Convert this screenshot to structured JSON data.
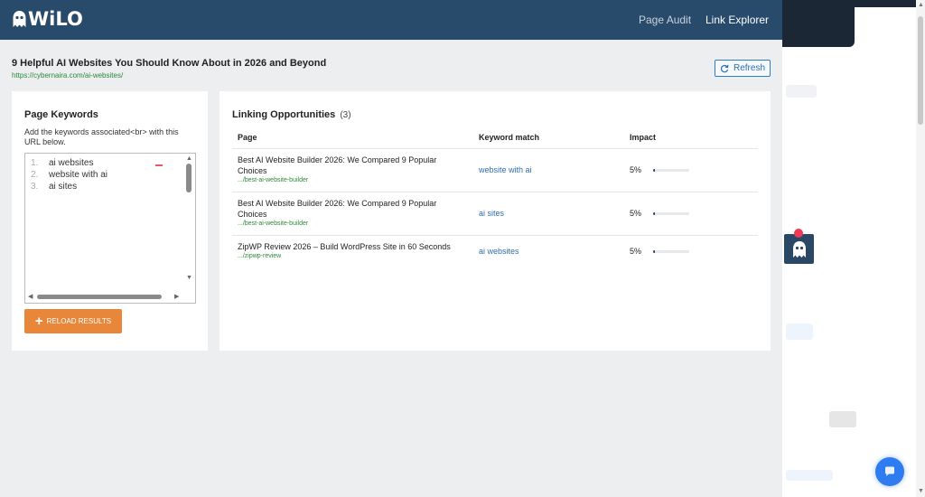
{
  "header": {
    "logo_text": "WiLO",
    "nav": [
      {
        "label": "Page Audit"
      },
      {
        "label": "Link Explorer"
      }
    ]
  },
  "page": {
    "title": "9 Helpful AI Websites You Should Know About in 2026 and Beyond",
    "url": "https://cybernaira.com/ai-websites/",
    "refresh_label": "Refresh"
  },
  "keywords_panel": {
    "title": "Page Keywords",
    "description": "Add the keywords associated<br> with this URL below.",
    "keywords": [
      {
        "num": "1.",
        "text": "ai websites"
      },
      {
        "num": "2.",
        "text": "website with ai"
      },
      {
        "num": "3.",
        "text": "ai sites"
      }
    ],
    "reload_label": "RELOAD RESULTS"
  },
  "linking": {
    "title": "Linking Opportunities",
    "count": "(3)",
    "columns": [
      "Page",
      "Keyword match",
      "Impact"
    ],
    "rows": [
      {
        "page_title": "Best AI Website Builder 2026: We Compared 9 Popular Choices",
        "page_url": ".../best-ai-website-builder",
        "keyword": "website with ai",
        "impact": "5%",
        "impact_value": 5
      },
      {
        "page_title": "Best AI Website Builder 2026: We Compared 9 Popular Choices",
        "page_url": ".../best-ai-website-builder",
        "keyword": "ai sites",
        "impact": "5%",
        "impact_value": 5
      },
      {
        "page_title": "ZipWP Review 2026 – Build WordPress Site in 60 Seconds",
        "page_url": ".../zipwp-review",
        "keyword": "ai websites",
        "impact": "5%",
        "impact_value": 5
      }
    ]
  },
  "colors": {
    "header_bg": "#284a6b",
    "accent_orange": "#e8873a",
    "link_blue": "#2f6fb0",
    "url_green": "#2a8a3a"
  }
}
